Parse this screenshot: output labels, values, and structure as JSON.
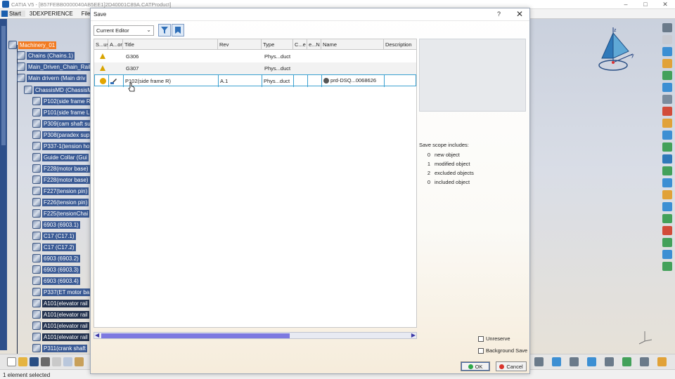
{
  "window": {
    "title": "CATIA V5 - [B57FEBB0000040AB5EE1]2D40001C89A.CATProduct]",
    "controls": [
      "–",
      "□",
      "✕"
    ]
  },
  "menubar": {
    "start": "Start",
    "items": [
      "3DEXPERIENCE",
      "File"
    ]
  },
  "tree": {
    "root": "Machinery_01",
    "items": [
      "Chains (Chains.1)",
      "Main_Driven_Chain_Rail",
      "Main drivern (Main driv",
      "ChassisMD (ChassisM",
      "P102(side frame R",
      "P101(side frame L",
      "P309(cam shaft su",
      "P308(paradex sup",
      "P337-1(tension ho",
      "Guide Collar (Gui",
      "F228(motor base)",
      "F228(motor base)",
      "F227(tension pin)",
      "F226(tension pin)",
      "F225(tensionChai",
      "6903 (6903.1)",
      "C17 (C17.1)",
      "C17 (C17.2)",
      "6903 (6903.2)",
      "6903 (6903.3)",
      "6903 (6903.4)",
      "P337(ET motor ba",
      "A101(elevator rail",
      "A101(elevator rail",
      "A101(elevator rail",
      "A101(elevator rail",
      "P311(crank shaft"
    ]
  },
  "dialog": {
    "title": "Save",
    "help": "?",
    "close": "✕",
    "editor_select": "Current Editor",
    "columns": [
      "S...us",
      "A...or",
      "Title",
      "Rev",
      "Type",
      "C...e",
      "e...N",
      "Name",
      "Description"
    ],
    "rows": [
      {
        "status": "warning",
        "title": "G306",
        "rev": "",
        "type": "Phys...duct",
        "name": ""
      },
      {
        "status": "warning",
        "title": "G307",
        "rev": "",
        "type": "Phys...duct",
        "name": ""
      },
      {
        "status": "info",
        "title": "P102(side frame R)",
        "rev": "A.1",
        "type": "Phys...duct",
        "name": "prd-DSQ...0068626"
      }
    ],
    "scope": {
      "header": "Save scope includes:",
      "lines": [
        {
          "count": "0",
          "label": "new object"
        },
        {
          "count": "1",
          "label": "modified object"
        },
        {
          "count": "2",
          "label": "excluded objects"
        },
        {
          "count": "0",
          "label": "included object"
        }
      ]
    },
    "unreserve_label": "Unreserve",
    "background_save_label": "Background Save",
    "ok_label": "OK",
    "cancel_label": "Cancel",
    "colors": {
      "ok_dot": "#2ea84a",
      "cancel_dot": "#d9342b",
      "selection_border": "#3aa0d0",
      "scroll_thumb": "#7d79e0"
    }
  },
  "status": {
    "text": "1 element selected"
  }
}
